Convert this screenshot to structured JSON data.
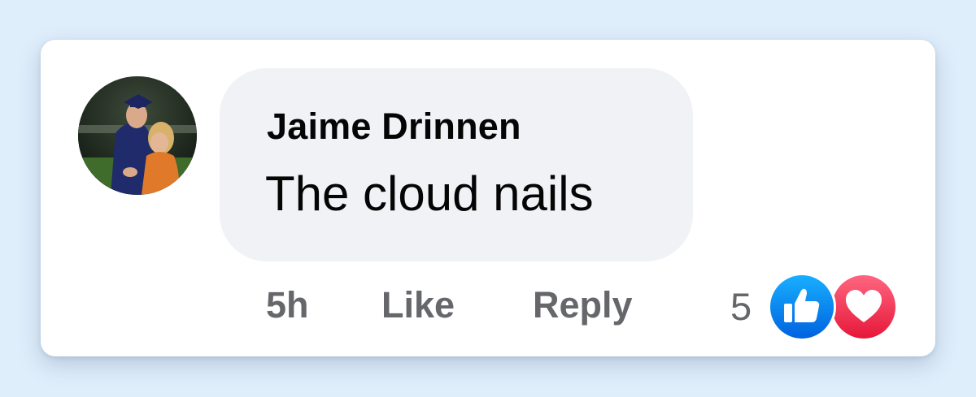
{
  "comment": {
    "author": "Jaime Drinnen",
    "text": "The cloud nails",
    "avatar": {
      "description_icon": "profile-photo-avatar"
    }
  },
  "actions": {
    "time": "5h",
    "like_label": "Like",
    "reply_label": "Reply"
  },
  "reactions": {
    "count": "5",
    "types": [
      "like-icon",
      "love-icon"
    ]
  },
  "colors": {
    "page_bg": "#dfeefb",
    "card_bg": "#ffffff",
    "bubble_bg": "#f0f2f5",
    "text_primary": "#050505",
    "text_secondary": "#65676b",
    "like_blue": "#1877f2",
    "love_red": "#f33e58"
  }
}
